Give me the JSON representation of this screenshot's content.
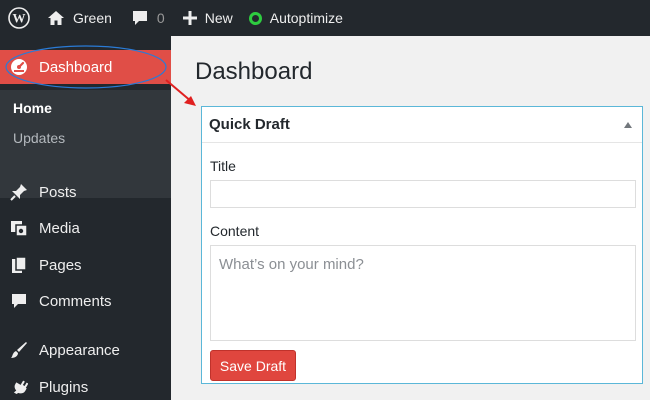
{
  "adminbar": {
    "site_name": "Green",
    "comment_count": "0",
    "new_label": "New",
    "autoptimize_label": "Autoptimize"
  },
  "sidebar": {
    "dashboard_label": "Dashboard",
    "submenu": [
      {
        "label": "Home",
        "current": true
      },
      {
        "label": "Updates",
        "current": false
      }
    ],
    "items": [
      {
        "label": "Posts",
        "icon": "pin-icon"
      },
      {
        "label": "Media",
        "icon": "media-icon"
      },
      {
        "label": "Pages",
        "icon": "pages-icon"
      },
      {
        "label": "Comments",
        "icon": "comment-icon"
      },
      {
        "label": "Appearance",
        "icon": "brush-icon"
      },
      {
        "label": "Plugins",
        "icon": "plugin-icon"
      }
    ]
  },
  "main": {
    "page_title": "Dashboard",
    "quick_draft": {
      "title": "Quick Draft",
      "title_label": "Title",
      "title_value": "",
      "content_label": "Content",
      "content_placeholder": "What’s on your mind?",
      "save_label": "Save Draft"
    }
  },
  "colors": {
    "adminbar_bg": "#23282d",
    "active_menu": "#e04e47",
    "save_button": "#e0463e",
    "annotation": "#e02020",
    "postbox_border": "#5bb7d8"
  }
}
